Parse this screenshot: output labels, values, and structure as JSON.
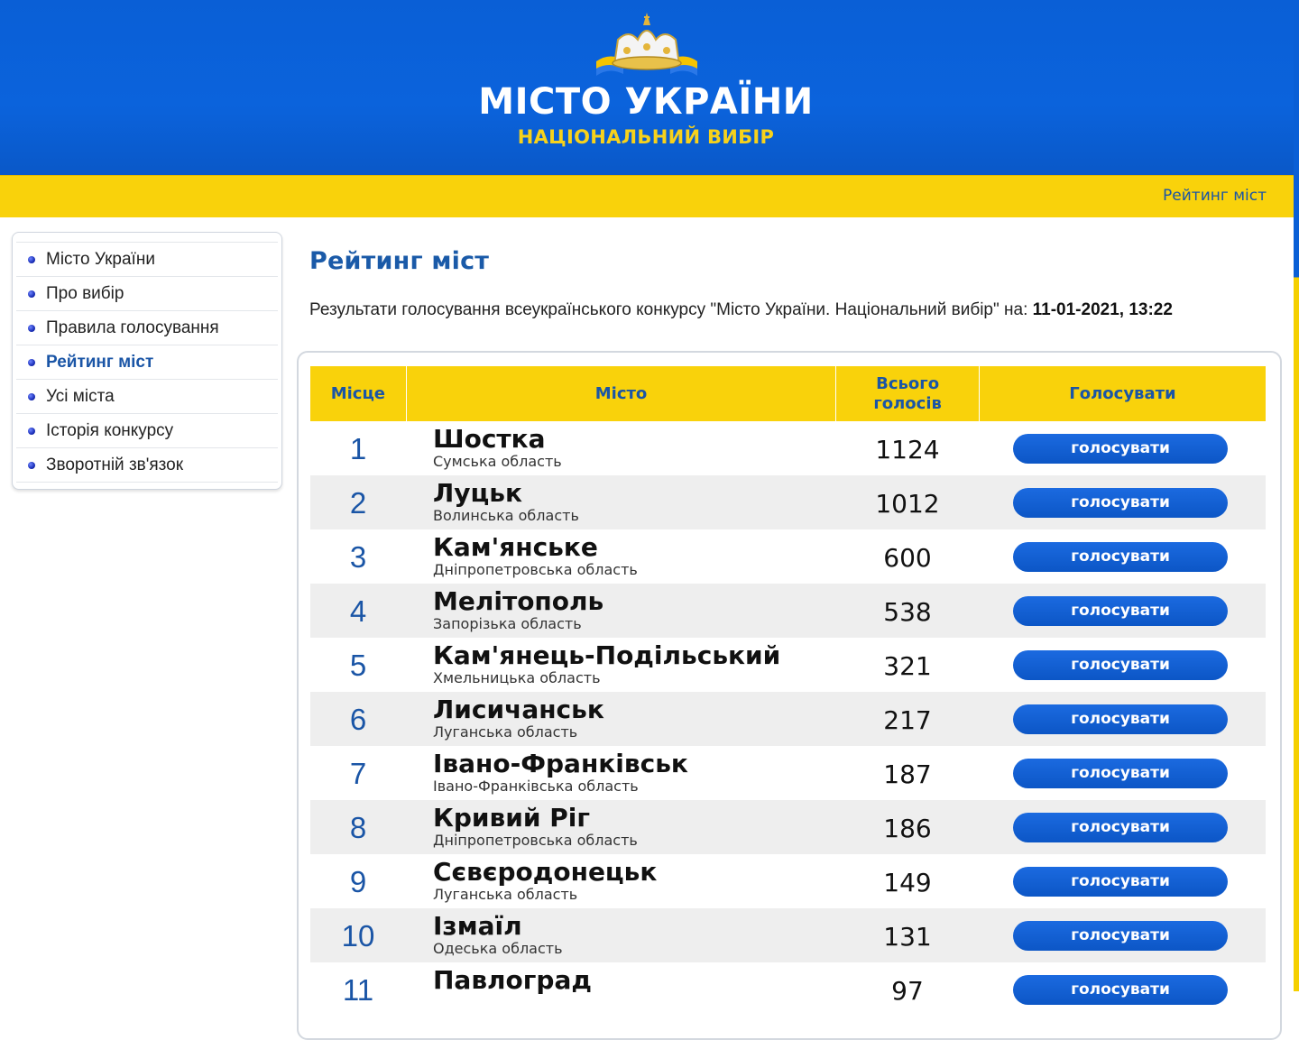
{
  "header": {
    "logo_title": "МІСТО УКРАЇНИ",
    "logo_subtitle": "НАЦІОНАЛЬНИЙ ВИБІР",
    "nav_link": "Рейтинг міст"
  },
  "sidebar": {
    "items": [
      {
        "label": "Місто України",
        "active": false
      },
      {
        "label": "Про вибір",
        "active": false
      },
      {
        "label": "Правила голосування",
        "active": false
      },
      {
        "label": "Рейтинг міст",
        "active": true
      },
      {
        "label": "Усі міста",
        "active": false
      },
      {
        "label": "Історія конкурсу",
        "active": false
      },
      {
        "label": "Зворотній зв'язок",
        "active": false
      }
    ]
  },
  "main": {
    "title": "Рейтинг міст",
    "results_text": "Результати голосування всеукраїнського конкурсу \"Місто України. Національний вибір\" на:",
    "results_datetime": "11-01-2021, 13:22"
  },
  "table": {
    "headers": {
      "place": "Місце",
      "city": "Місто",
      "votes_line1": "Всього",
      "votes_line2": "голосів",
      "vote": "Голосувати"
    },
    "button_label": "голосувати",
    "rows": [
      {
        "place": "1",
        "city": "Шостка",
        "region": "Сумська область",
        "votes": "1124"
      },
      {
        "place": "2",
        "city": "Луцьк",
        "region": "Волинська область",
        "votes": "1012"
      },
      {
        "place": "3",
        "city": "Кам'янське",
        "region": "Дніпропетровська область",
        "votes": "600"
      },
      {
        "place": "4",
        "city": "Мелітополь",
        "region": "Запорізька область",
        "votes": "538"
      },
      {
        "place": "5",
        "city": "Кам'янець-Подільський",
        "region": "Хмельницька область",
        "votes": "321"
      },
      {
        "place": "6",
        "city": "Лисичанськ",
        "region": "Луганська область",
        "votes": "217"
      },
      {
        "place": "7",
        "city": "Івано-Франківськ",
        "region": "Івано-Франківська область",
        "votes": "187"
      },
      {
        "place": "8",
        "city": "Кривий Ріг",
        "region": "Дніпропетровська область",
        "votes": "186"
      },
      {
        "place": "9",
        "city": "Сєвєродонецьк",
        "region": "Луганська область",
        "votes": "149"
      },
      {
        "place": "10",
        "city": "Ізмаїл",
        "region": "Одеська область",
        "votes": "131"
      },
      {
        "place": "11",
        "city": "Павлоград",
        "region": "",
        "votes": "97"
      }
    ]
  },
  "colors": {
    "header_blue": "#0b63dc",
    "bar_yellow": "#f9d20b",
    "accent_blue": "#1a55a6",
    "logo_gold": "#f7d21b"
  }
}
